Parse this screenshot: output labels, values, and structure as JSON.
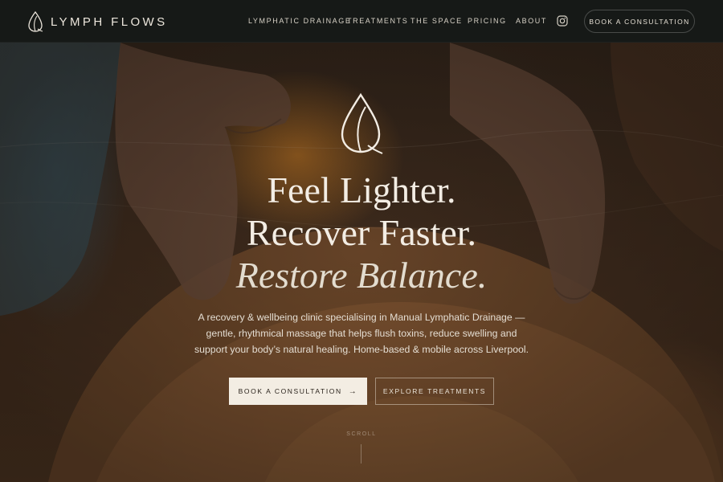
{
  "brand": {
    "name": "LYMPH FLOWS",
    "icon": "drop-leaf-logo-icon"
  },
  "nav": {
    "links": [
      {
        "label": "LYMPHATIC DRAINAGE"
      },
      {
        "label": "TREATMENTS"
      },
      {
        "label": "THE SPACE"
      },
      {
        "label": "PRICING"
      },
      {
        "label": "ABOUT"
      }
    ],
    "social_icon": "instagram-icon",
    "cta_label": "BOOK A CONSULTATION"
  },
  "hero": {
    "icon": "drop-leaf-logo-icon",
    "headline_1": "Feel Lighter.",
    "headline_2": "Recover Faster.",
    "headline_3": "Restore Balance.",
    "subtext_1": "A recovery & wellbeing clinic specialising in Manual Lymphatic Drainage —",
    "subtext_2": "gentle, rhythmical massage that helps flush toxins, reduce swelling and",
    "subtext_3": "support your body’s natural healing. Home-based & mobile across Liverpool.",
    "primary_label": "BOOK A CONSULTATION",
    "primary_arrow": "→",
    "secondary_label": "EXPLORE TREATMENTS",
    "scroll_label": "SCROLL"
  },
  "colors": {
    "nav_bg": "#161917",
    "text_light": "#f3ede4",
    "button_light": "#f3ede3",
    "accent_warm": "#d68428"
  }
}
